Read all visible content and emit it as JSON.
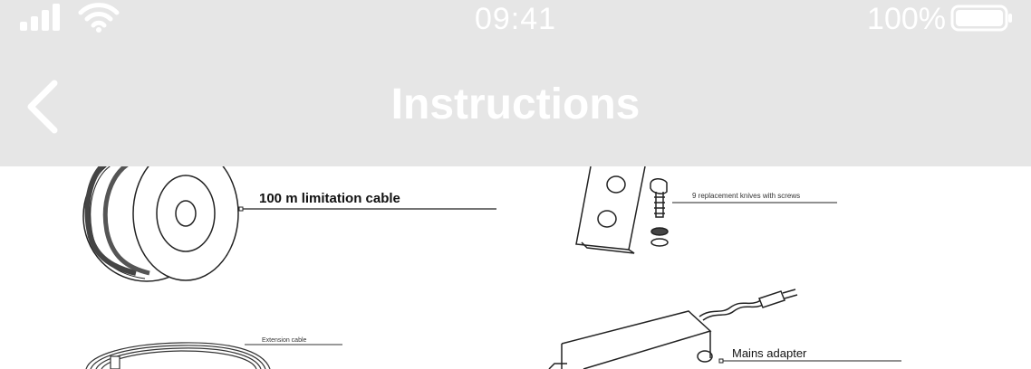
{
  "status_bar": {
    "time": "09:41",
    "battery_percent": "100%",
    "signal_icon": "cellular-signal-icon",
    "wifi_icon": "wifi-icon",
    "battery_icon": "battery-full-icon"
  },
  "nav": {
    "title": "Instructions",
    "back_icon": "chevron-left-icon"
  },
  "illustration": {
    "labels": {
      "limitation_cable": "100 m limitation cable",
      "replacement_knives": "9 replacement knives with screws",
      "extension_cable": "Extension cable",
      "mains_adapter": "Mains adapter"
    }
  },
  "colors": {
    "header_bg": "#e6e6e6",
    "header_text": "#ffffff",
    "content_bg": "#ffffff",
    "line_art": "#222222"
  }
}
